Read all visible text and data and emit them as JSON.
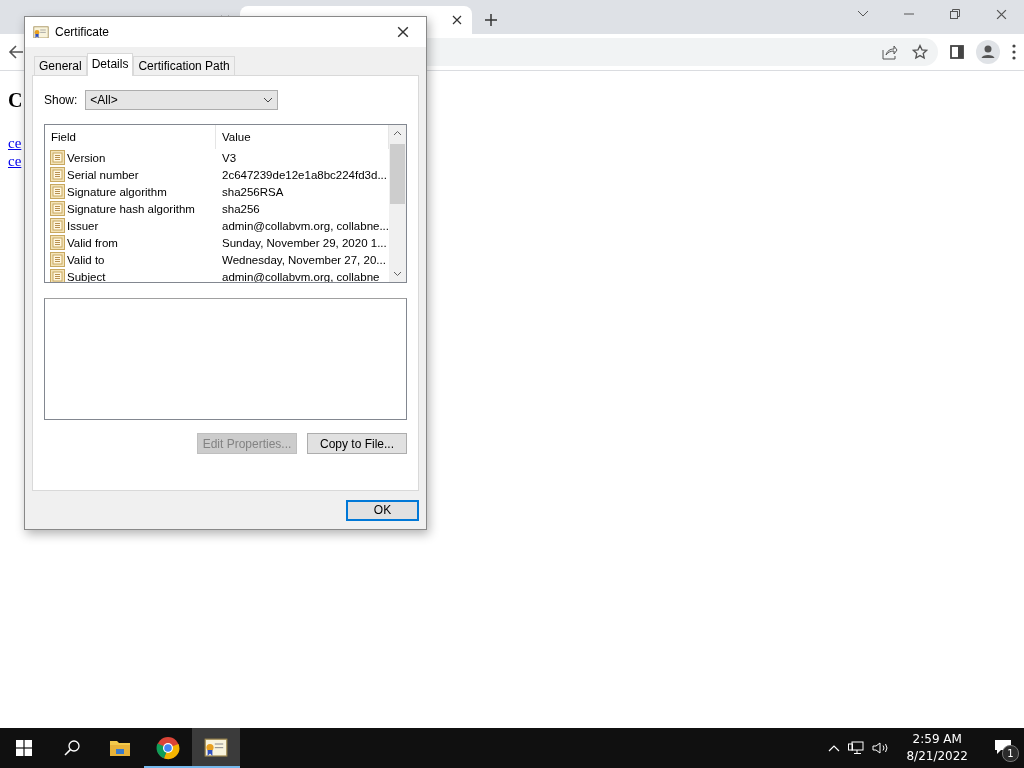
{
  "browser": {
    "tabs": [
      {
        "selected": false
      },
      {
        "selected": true
      }
    ]
  },
  "page": {
    "heading": "C",
    "links": [
      "ce",
      "ce"
    ]
  },
  "dialog": {
    "title": "Certificate",
    "tabs": [
      {
        "label": "General",
        "selected": false
      },
      {
        "label": "Details",
        "selected": true
      },
      {
        "label": "Certification Path",
        "selected": false
      }
    ],
    "show_label": "Show:",
    "show_value": "<All>",
    "columns": [
      "Field",
      "Value"
    ],
    "rows": [
      {
        "field": "Version",
        "value": "V3"
      },
      {
        "field": "Serial number",
        "value": "2c647239de12e1a8bc224fd3d..."
      },
      {
        "field": "Signature algorithm",
        "value": "sha256RSA"
      },
      {
        "field": "Signature hash algorithm",
        "value": "sha256"
      },
      {
        "field": "Issuer",
        "value": "admin@collabvm.org, collabne..."
      },
      {
        "field": "Valid from",
        "value": "Sunday, November 29, 2020 1..."
      },
      {
        "field": "Valid to",
        "value": "Wednesday, November 27, 20..."
      },
      {
        "field": "Subject",
        "value": "admin@collabvm.org, collabne"
      }
    ],
    "buttons": [
      {
        "label": "Edit Properties...",
        "disabled": true
      },
      {
        "label": "Copy to File...",
        "disabled": false
      }
    ],
    "ok": "OK"
  },
  "taskbar": {
    "apps": [
      {
        "kind": "folder",
        "running": false,
        "selected": false
      },
      {
        "kind": "chrome",
        "running": true,
        "selected": false
      },
      {
        "kind": "certificate",
        "running": true,
        "selected": true
      }
    ],
    "time": "2:59 AM",
    "date": "8/21/2022",
    "notification_count": "1"
  }
}
